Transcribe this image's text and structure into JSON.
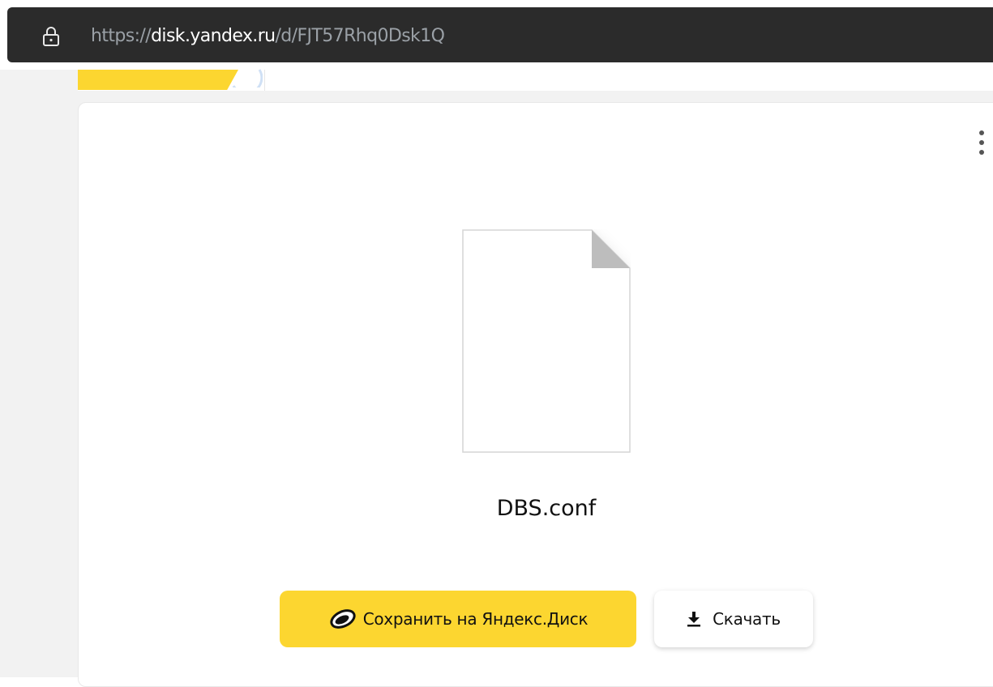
{
  "browser": {
    "url_scheme": "https://",
    "url_host": "disk.yandex.ru",
    "url_path": "/d/FJT57Rhq0Dsk1Q"
  },
  "header": {
    "logo_color": "#fcd630"
  },
  "file": {
    "name": "DBS.conf",
    "icon": "document-icon"
  },
  "actions": {
    "save_label": "Сохранить на Яндекс.Диск",
    "download_label": "Скачать",
    "more_icon": "more-vertical-icon"
  },
  "colors": {
    "accent": "#fcd630",
    "addressbar": "#2b2b2b",
    "page_bg": "#f2f2f2"
  }
}
